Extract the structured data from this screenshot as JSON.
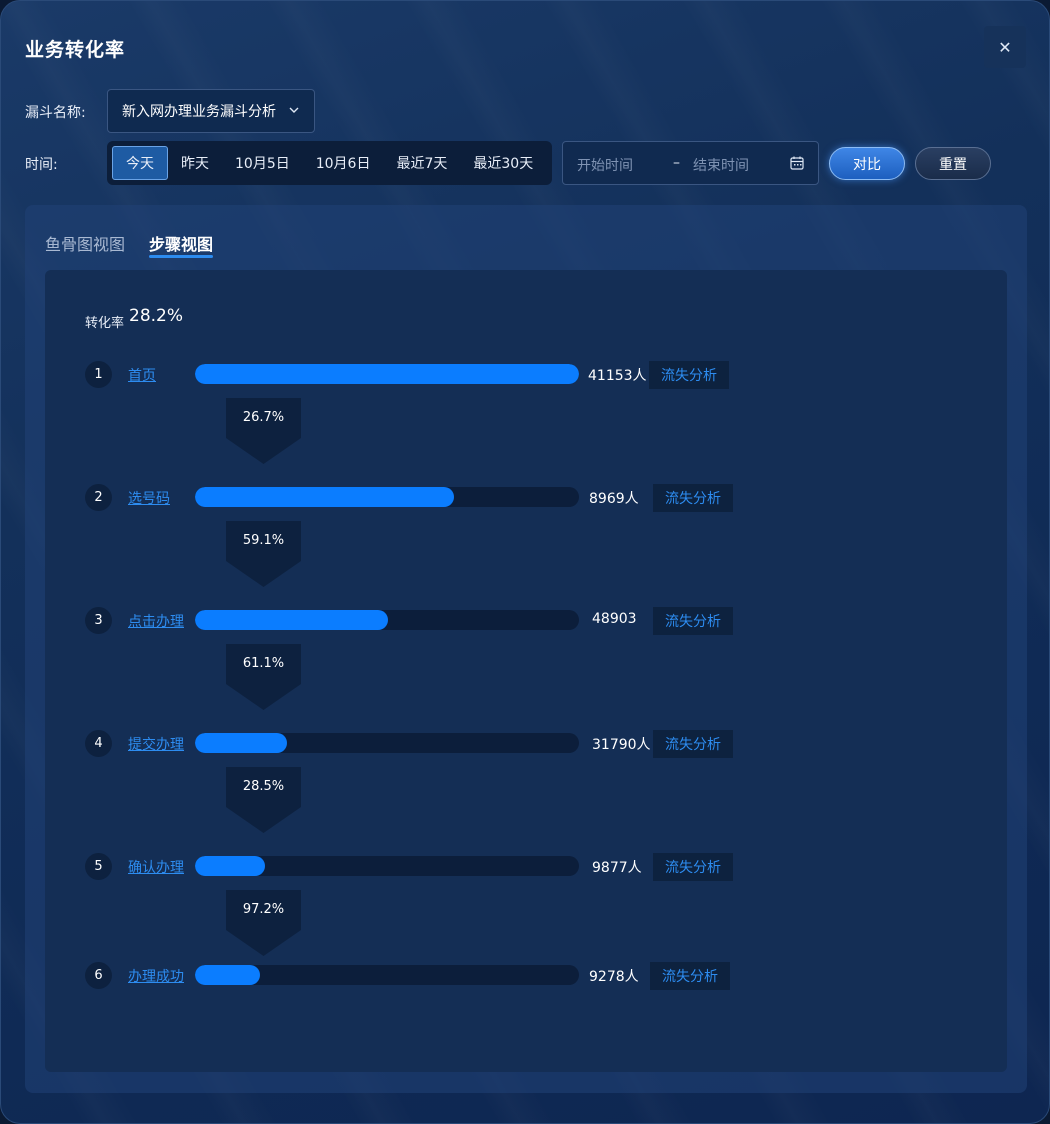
{
  "dialog": {
    "title": "业务转化率",
    "close_glyph": "✕"
  },
  "filters": {
    "funnel_label": "漏斗名称:",
    "funnel_value": "新入网办理业务漏斗分析",
    "time_label": "时间:",
    "ranges": [
      "今天",
      "昨天",
      "10月5日",
      "10月6日",
      "最近7天",
      "最近30天"
    ],
    "active_range": "今天",
    "start_placeholder": "开始时间",
    "separator": "–",
    "end_placeholder": "结束时间",
    "contrast_label": "对比",
    "reset_label": "重置"
  },
  "tabs": [
    {
      "label": "鱼骨图视图",
      "active": false
    },
    {
      "label": "步骤视图",
      "active": true
    }
  ],
  "conversion": {
    "label": "转化率",
    "value": "28.2%"
  },
  "loss_label": "流失分析",
  "steps": [
    {
      "num": "1",
      "name": "首页",
      "count": "41153人",
      "fill": 1.0
    },
    {
      "num": "2",
      "name": "选号码",
      "count": "8969人",
      "fill": 0.675
    },
    {
      "num": "3",
      "name": "点击办理",
      "count": "48903",
      "fill": 0.503
    },
    {
      "num": "4",
      "name": "提交办理",
      "count": "31790人",
      "fill": 0.24
    },
    {
      "num": "5",
      "name": "确认办理",
      "count": "9877人",
      "fill": 0.183
    },
    {
      "num": "6",
      "name": "办理成功",
      "count": "9278人",
      "fill": 0.17
    }
  ],
  "transitions": [
    "26.7%",
    "59.1%",
    "61.1%",
    "28.5%",
    "97.2%"
  ],
  "colors": {
    "accent": "#2d8cf0",
    "bar_fill": "#0b7dff",
    "track": "#0c1e3b",
    "panel": "#142e55"
  }
}
